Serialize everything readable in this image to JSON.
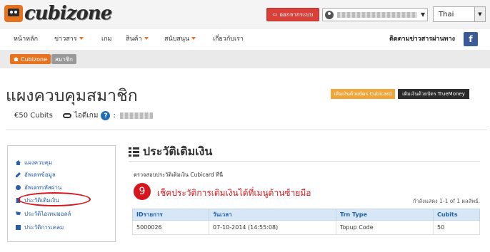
{
  "header": {
    "logo_text": "cubizone",
    "logout_label": "ออกจากระบบ",
    "language": "Thai"
  },
  "nav": {
    "items": [
      {
        "label": "หน้าหลัก",
        "dropdown": false
      },
      {
        "label": "ข่าวสาร",
        "dropdown": true
      },
      {
        "label": "เกม",
        "dropdown": false
      },
      {
        "label": "สินค้า",
        "dropdown": true
      },
      {
        "label": "สนับสนุน",
        "dropdown": true
      },
      {
        "label": "เกี่ยวกับเรา",
        "dropdown": false
      }
    ],
    "follow_label": "ติดตามข่าวสารผ่านทาง",
    "facebook_label": "f"
  },
  "breadcrumb": {
    "home": "Cubizone",
    "current": "สมาชิก"
  },
  "profile": {
    "title": "แผงควบคุมสมาชิก",
    "cubits": "€50  Cubits",
    "game_id_label": "ไอดีเกม",
    "help": "?",
    "colon": ":"
  },
  "topup_buttons": {
    "cubicard": "เติมเงินด้วยบัตร Cubicard",
    "truemoney": "เติมเงินด้วยบัตร TrueMoney"
  },
  "sidebar": {
    "items": [
      {
        "label": "แผงควบคุม",
        "icon": "home-icon"
      },
      {
        "label": "อัพเดทข้อมูล",
        "icon": "edit-icon"
      },
      {
        "label": "อัพเดทรหัสผ่าน",
        "icon": "key-icon"
      },
      {
        "label": "ประวัติเติมเงิน",
        "icon": "credit-card-icon"
      },
      {
        "label": "ประวัติไอเทมมอลล์",
        "icon": "cart-icon"
      },
      {
        "label": "ประวัติการเคลม",
        "icon": "gift-icon"
      }
    ]
  },
  "content": {
    "section_title": "ประวัติเติมเงิน",
    "description": "ตรวจสอบประวัติเติมเงิน Cubicard ที่นี่",
    "step_number": "9",
    "step_text": "เช็คประวัติการเติมเงินได้ที่เมนูด้านซ้ายมือ",
    "showing": "กำลังแสดง 1-1    of  1   ผลลัพธ์.",
    "table": {
      "headers": [
        "IDรายการ",
        "วันเวลา",
        "Trn Type",
        "Cubits"
      ],
      "rows": [
        [
          "5000026",
          "07-10-2014 (14:55:08)",
          "Topup Code",
          "50"
        ]
      ]
    }
  },
  "colors": {
    "brand_orange": "#e8731e",
    "logout_red": "#d9403a",
    "annotation_red": "#d8151c",
    "link_blue": "#2a5fa8",
    "table_header_bg": "#d7e7f6",
    "facebook_blue": "#3b5b98"
  }
}
